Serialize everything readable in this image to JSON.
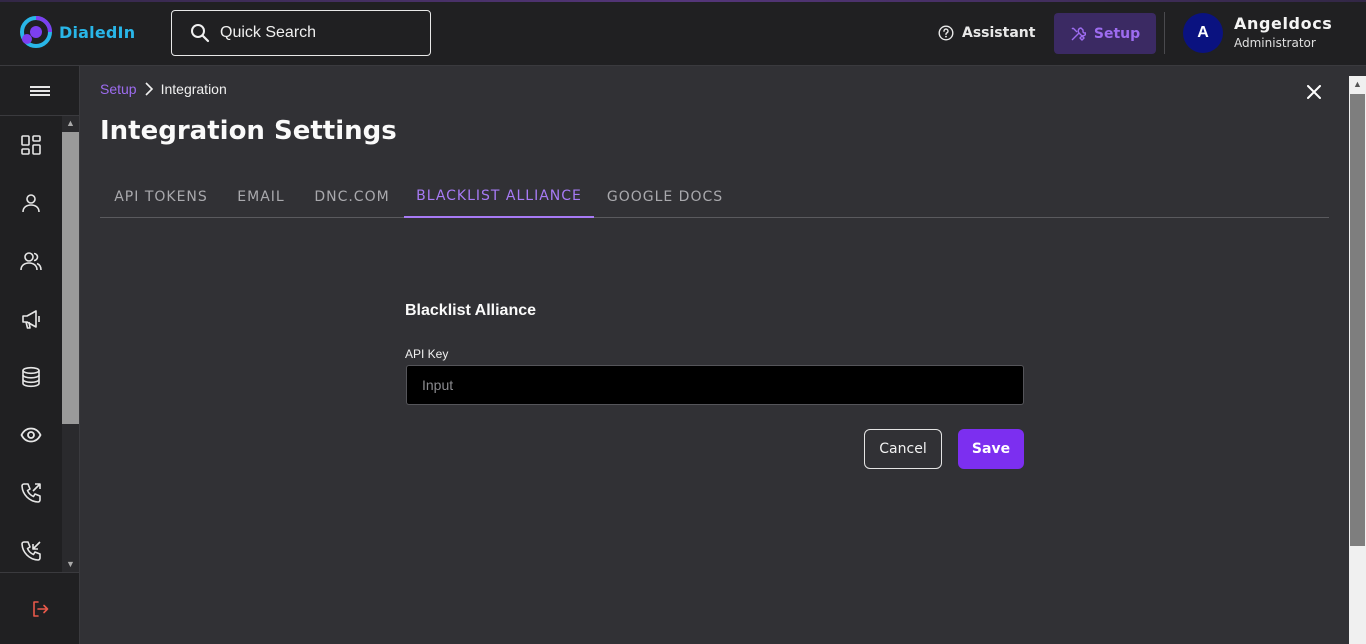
{
  "app": {
    "logo_text": "DialedIn",
    "search_label": "Quick Search"
  },
  "header": {
    "assistant_label": "Assistant",
    "setup_label": "Setup",
    "user": {
      "initial": "A",
      "name": "Angeldocs",
      "role": "Administrator"
    }
  },
  "sidebar": {
    "items": [
      {
        "icon": "dashboard-icon"
      },
      {
        "icon": "user-icon"
      },
      {
        "icon": "users-icon"
      },
      {
        "icon": "megaphone-icon"
      },
      {
        "icon": "database-icon"
      },
      {
        "icon": "eye-icon"
      },
      {
        "icon": "outgoing-call-icon"
      },
      {
        "icon": "incoming-call-icon"
      }
    ],
    "logout_icon": "logout-icon"
  },
  "breadcrumb": {
    "parent": "Setup",
    "current": "Integration"
  },
  "page": {
    "title": "Integration Settings"
  },
  "tabs": [
    {
      "label": "API TOKENS",
      "active": false
    },
    {
      "label": "EMAIL",
      "active": false
    },
    {
      "label": "DNC.COM",
      "active": false
    },
    {
      "label": "BLACKLIST ALLIANCE",
      "active": true
    },
    {
      "label": "GOOGLE DOCS",
      "active": false
    }
  ],
  "form": {
    "title": "Blacklist Alliance",
    "api_key_label": "API Key",
    "api_key_value": "",
    "api_key_placeholder": "Input",
    "cancel_label": "Cancel",
    "save_label": "Save"
  },
  "colors": {
    "accent": "#9d6cf0",
    "primary_button": "#7c2ff0",
    "avatar": "#0a1280",
    "logo": "#29b6e8"
  }
}
